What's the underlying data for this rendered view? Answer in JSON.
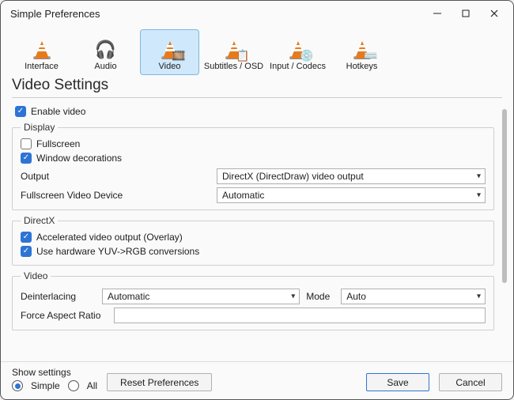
{
  "window": {
    "title": "Simple Preferences"
  },
  "categories": [
    {
      "key": "interface",
      "label": "Interface"
    },
    {
      "key": "audio",
      "label": "Audio"
    },
    {
      "key": "video",
      "label": "Video"
    },
    {
      "key": "subtitles",
      "label": "Subtitles / OSD"
    },
    {
      "key": "codecs",
      "label": "Input / Codecs"
    },
    {
      "key": "hotkeys",
      "label": "Hotkeys"
    }
  ],
  "categories_selected": "video",
  "heading": "Video Settings",
  "enable_video": {
    "label": "Enable video",
    "checked": true
  },
  "display": {
    "legend": "Display",
    "fullscreen": {
      "label": "Fullscreen",
      "checked": false
    },
    "window_decorations": {
      "label": "Window decorations",
      "checked": true
    },
    "output": {
      "label": "Output",
      "value": "DirectX (DirectDraw) video output"
    },
    "fullscreen_device": {
      "label": "Fullscreen Video Device",
      "value": "Automatic"
    }
  },
  "directx": {
    "legend": "DirectX",
    "accel": {
      "label": "Accelerated video output (Overlay)",
      "checked": true
    },
    "yuv": {
      "label": "Use hardware YUV->RGB conversions",
      "checked": true
    }
  },
  "video": {
    "legend": "Video",
    "deinterlacing": {
      "label": "Deinterlacing",
      "value": "Automatic"
    },
    "mode": {
      "label": "Mode",
      "value": "Auto"
    },
    "force_aspect": {
      "label": "Force Aspect Ratio",
      "value": ""
    }
  },
  "footer": {
    "show_settings_label": "Show settings",
    "simple": "Simple",
    "all": "All",
    "selected": "simple",
    "reset": "Reset Preferences",
    "save": "Save",
    "cancel": "Cancel"
  }
}
